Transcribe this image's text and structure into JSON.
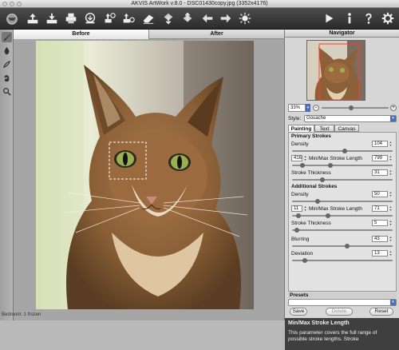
{
  "window": {
    "title": "AKVIS ArtWork v.8.0 - DSC01430copy.jpg (3352x4176)"
  },
  "toolbar": {
    "left_icons": [
      "logo-icon",
      "open-icon",
      "save-icon",
      "print-icon",
      "share-icon",
      "batch-icon",
      "preferences-icon",
      "settings-icon",
      "eraser-icon",
      "import-icon",
      "export-icon",
      "undo-icon",
      "redo-icon",
      "effect-icon"
    ],
    "right_icons": [
      "run-icon",
      "info-icon",
      "help-icon",
      "preferences-gear-icon"
    ]
  },
  "left_tools": [
    "brush-icon",
    "drop-icon",
    "pen-icon",
    "hand-icon",
    "zoom-icon"
  ],
  "canvas": {
    "tabs": {
      "before": "Before",
      "after": "After"
    }
  },
  "status": {
    "text": "Bedroom: 1 frozen"
  },
  "navigator": {
    "title": "Navigator",
    "zoom": "33%",
    "zoom_minus": "−",
    "zoom_plus": "+"
  },
  "style": {
    "label": "Style:",
    "value": "Gouache"
  },
  "param_tabs": [
    "Painting",
    "Text",
    "Canvas"
  ],
  "primary": {
    "title": "Primary Strokes",
    "density_label": "Density",
    "density_value": "104",
    "minmax_label": "Min/Max Stroke Length",
    "min_value": "416",
    "max_value": "799",
    "thickness_label": "Stroke Thickness",
    "thickness_value": "31"
  },
  "additional": {
    "title": "Additional Strokes",
    "density_label": "Density",
    "density_value": "50",
    "minmax_label": "Min/Max Stroke Length",
    "min_value": "11",
    "max_value": "71",
    "thickness_label": "Stroke Thickness",
    "thickness_value": "5"
  },
  "blurring": {
    "label": "Blurring",
    "value": "43"
  },
  "deviation": {
    "label": "Deviation",
    "value": "13"
  },
  "slider_levels": {
    "p_density": 0.52,
    "p_min": 0.1,
    "p_max": 0.38,
    "p_thick": 0.3,
    "a_density": 0.25,
    "a_min": 0.06,
    "a_max": 0.36,
    "a_thick": 0.05,
    "blur": 0.55,
    "dev": 0.13
  },
  "presets": {
    "title": "Presets",
    "value": "",
    "save": "Save",
    "delete": "Delete",
    "reset": "Reset"
  },
  "help": {
    "title": "Min/Max Stroke Length",
    "text": "This parameter covers the full range of possible stroke lengths. Stroke"
  }
}
